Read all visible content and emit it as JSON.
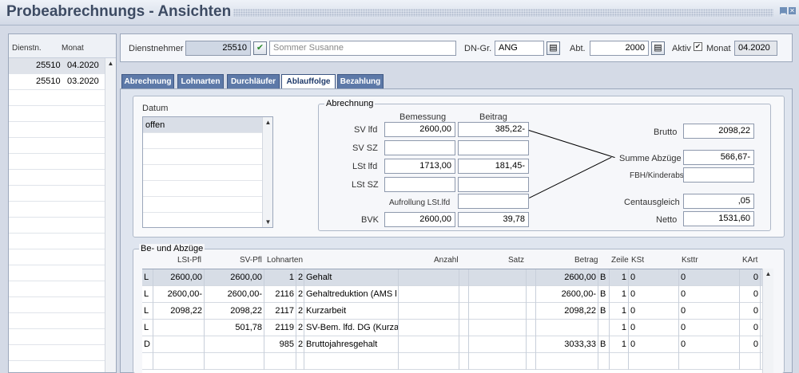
{
  "window": {
    "title": "Probeabrechnungs - Ansichten"
  },
  "left": {
    "col_dienstn": "Dienstn.",
    "col_monat": "Monat",
    "rows": [
      {
        "dienstn": "25510",
        "monat": "04.2020"
      },
      {
        "dienstn": "25510",
        "monat": "03.2020"
      }
    ]
  },
  "header": {
    "dienstnehmer_label": "Dienstnehmer",
    "dienstnehmer_id": "25510",
    "dienstnehmer_name": "Sommer Susanne",
    "dngr_label": "DN-Gr.",
    "dngr_value": "ANG",
    "abt_label": "Abt.",
    "abt_value": "2000",
    "aktiv_label": "Aktiv",
    "monat_label": "Monat",
    "monat_value": "04.2020"
  },
  "tabs": [
    "Abrechnung",
    "Lohnarten",
    "Durchläufer",
    "Ablauffolge",
    "Bezahlung"
  ],
  "datum": {
    "legend": "Datum",
    "items": [
      "offen"
    ]
  },
  "abrechnung": {
    "legend": "Abrechnung",
    "col_bemessung": "Bemessung",
    "col_beitrag": "Beitrag",
    "sv_lfd": "SV lfd",
    "sv_sz": "SV SZ",
    "lst_lfd": "LSt lfd",
    "lst_sz": "LSt SZ",
    "bvk": "BVK",
    "aufrollung": "Aufrollung LSt.lfd",
    "sv_lfd_bem": "2600,00",
    "sv_lfd_bei": "385,22-",
    "lst_lfd_bem": "1713,00",
    "lst_lfd_bei": "181,45-",
    "bvk_bem": "2600,00",
    "bvk_bei": "39,78",
    "brutto_label": "Brutto",
    "brutto": "2098,22",
    "summe_label": "Summe Abzüge",
    "summe": "566,67-",
    "fbh_label": "FBH/Kinderabs.",
    "cent_label": "Centausgleich",
    "cent": ",05",
    "netto_label": "Netto",
    "netto": "1531,60"
  },
  "bezuege": {
    "legend": "Be- und Abzüge",
    "headers": {
      "lst": "LSt-Pfl",
      "sv": "SV-Pfl",
      "lohnarten": "Lohnarten",
      "anzahl": "Anzahl",
      "satz": "Satz",
      "betrag": "Betrag",
      "zeile": "Zeile",
      "kst": "KSt",
      "ksttr": "Ksttr",
      "kart": "KArt"
    },
    "rows": [
      {
        "t": "L",
        "lst": "2600,00",
        "sv": "2600,00",
        "nr": "1",
        "k": "2",
        "name": "Gehalt",
        "betrag": "2600,00",
        "b": "B",
        "zeile": "1",
        "kst": "0",
        "ksttr": "0",
        "kart": "0"
      },
      {
        "t": "L",
        "lst": "2600,00-",
        "sv": "2600,00-",
        "nr": "2116",
        "k": "2",
        "name": "Gehaltreduktion (AMS l",
        "betrag": "2600,00-",
        "b": "B",
        "zeile": "1",
        "kst": "0",
        "ksttr": "0",
        "kart": "0"
      },
      {
        "t": "L",
        "lst": "2098,22",
        "sv": "2098,22",
        "nr": "2117",
        "k": "2",
        "name": "Kurzarbeit",
        "betrag": "2098,22",
        "b": "B",
        "zeile": "1",
        "kst": "0",
        "ksttr": "0",
        "kart": "0"
      },
      {
        "t": "L",
        "lst": "",
        "sv": "501,78",
        "nr": "2119",
        "k": "2",
        "name": "SV-Bem. lfd. DG (Kurza",
        "betrag": "",
        "b": "",
        "zeile": "1",
        "kst": "0",
        "ksttr": "0",
        "kart": "0"
      },
      {
        "t": "D",
        "lst": "",
        "sv": "",
        "nr": "985",
        "k": "2",
        "name": "Bruttojahresgehalt",
        "betrag": "3033,33",
        "b": "B",
        "zeile": "1",
        "kst": "0",
        "ksttr": "0",
        "kart": "0"
      }
    ]
  }
}
